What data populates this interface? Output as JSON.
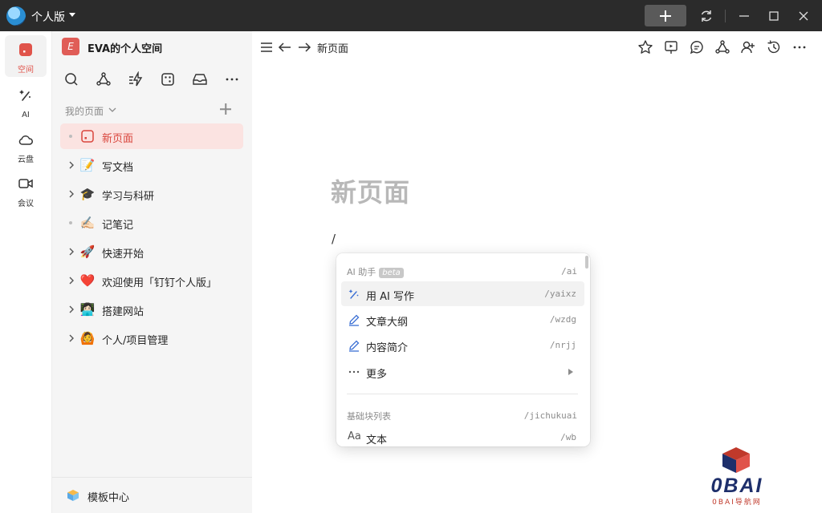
{
  "titlebar": {
    "app_name": "个人版"
  },
  "rail": {
    "items": [
      {
        "label": "空间",
        "icon": "space-icon",
        "active": true
      },
      {
        "label": "AI",
        "icon": "ai-wand-icon"
      },
      {
        "label": "云盘",
        "icon": "cloud-icon"
      },
      {
        "label": "会议",
        "icon": "video-icon"
      }
    ]
  },
  "sidebar": {
    "space_badge": "E",
    "space_title": "EVA的个人空间",
    "section_label": "我的页面",
    "tree": [
      {
        "label": "新页面",
        "emoji": "",
        "type": "dot",
        "active": true
      },
      {
        "label": "写文档",
        "emoji": "📝",
        "type": "chevron"
      },
      {
        "label": "学习与科研",
        "emoji": "🎓",
        "type": "chevron"
      },
      {
        "label": "记笔记",
        "emoji": "✍🏻",
        "type": "dot"
      },
      {
        "label": "快速开始",
        "emoji": "🚀",
        "type": "chevron"
      },
      {
        "label": "欢迎使用「钉钉个人版」",
        "emoji": "❤️",
        "type": "chevron"
      },
      {
        "label": "搭建网站",
        "emoji": "👩🏻‍💻",
        "type": "chevron"
      },
      {
        "label": "个人/项目管理",
        "emoji": "🙆",
        "type": "chevron"
      }
    ],
    "footer_label": "模板中心"
  },
  "main": {
    "breadcrumb": "新页面",
    "page_title": "新页面",
    "slash_text": "/"
  },
  "menu": {
    "ai_section": "AI 助手",
    "beta_badge": "beta",
    "ai_shortcut": "/ai",
    "items": [
      {
        "label": "用 AI 写作",
        "shortcut": "/yaixz",
        "icon": "ai-wand-icon"
      },
      {
        "label": "文章大纲",
        "shortcut": "/wzdg",
        "icon": "pen-icon"
      },
      {
        "label": "内容简介",
        "shortcut": "/nrjj",
        "icon": "pen-icon"
      },
      {
        "label": "更多",
        "shortcut": "",
        "icon": "more-icon"
      }
    ],
    "block_section": "基础块列表",
    "block_shortcut": "/jichukuai",
    "text_icon": "Aa",
    "text_label": "文本",
    "text_shortcut": "/wb"
  },
  "watermark": {
    "logo_text": "0BAI",
    "logo_sub": "0BAI导航网"
  },
  "colors": {
    "accent": "#e0534a",
    "titlebar": "#2b2b2b",
    "sidebar_bg": "#f5f5f5"
  }
}
